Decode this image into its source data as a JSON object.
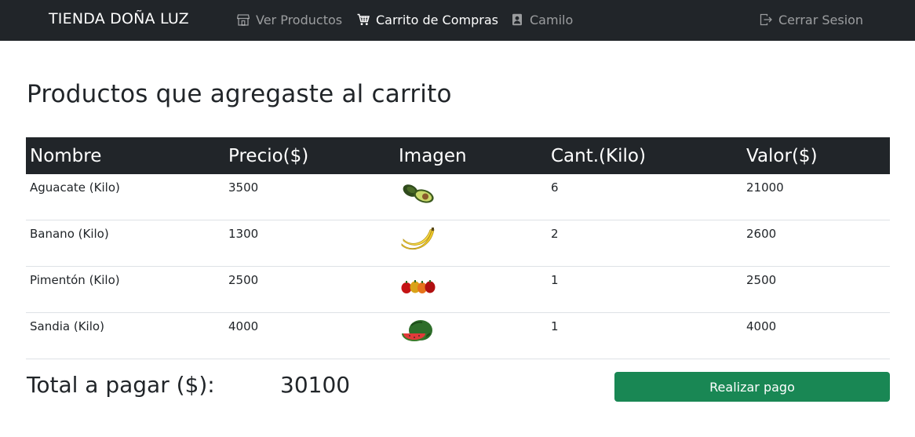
{
  "brand": "TIENDA DOÑA LUZ",
  "nav": {
    "products": {
      "label": "Ver Productos",
      "icon": "store-icon"
    },
    "cart": {
      "label": "Carrito de Compras",
      "icon": "cart-icon"
    },
    "user": {
      "label": "Camilo",
      "icon": "user-badge-icon"
    },
    "logout": {
      "label": "Cerrar Sesion",
      "icon": "logout-icon"
    }
  },
  "page_title": "Productos que agregaste al carrito",
  "table": {
    "headers": [
      "Nombre",
      "Precio($)",
      "Imagen",
      "Cant.(Kilo)",
      "Valor($)"
    ],
    "rows": [
      {
        "name": "Aguacate (Kilo)",
        "price": "3500",
        "image": "avocado-image",
        "qty": "6",
        "value": "21000"
      },
      {
        "name": "Banano (Kilo)",
        "price": "1300",
        "image": "banana-image",
        "qty": "2",
        "value": "2600"
      },
      {
        "name": "Pimentón (Kilo)",
        "price": "2500",
        "image": "pepper-image",
        "qty": "1",
        "value": "2500"
      },
      {
        "name": "Sandia (Kilo)",
        "price": "4000",
        "image": "watermelon-image",
        "qty": "1",
        "value": "4000"
      }
    ]
  },
  "summary": {
    "label": "Total a pagar ($):",
    "total": "30100"
  },
  "pay_button": "Realizar pago",
  "colors": {
    "navbar": "#212529",
    "pay_button": "#198754"
  }
}
